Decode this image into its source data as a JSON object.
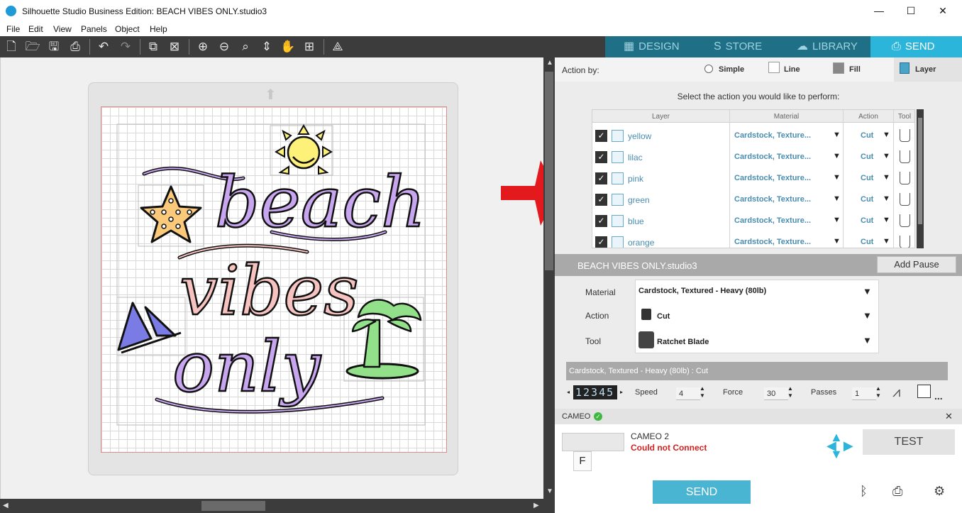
{
  "window": {
    "title": "Silhouette Studio Business Edition: BEACH VIBES ONLY.studio3",
    "minimize": "—",
    "maximize": "☐",
    "close": "✕"
  },
  "menu": [
    "File",
    "Edit",
    "View",
    "Panels",
    "Object",
    "Help"
  ],
  "nav_tabs": [
    {
      "label": "DESIGN",
      "icon": "grid-icon",
      "glyph": "▦"
    },
    {
      "label": "STORE",
      "icon": "store-s-icon",
      "glyph": "S"
    },
    {
      "label": "LIBRARY",
      "icon": "cloud-icon",
      "glyph": "☁"
    },
    {
      "label": "SEND",
      "icon": "cutter-icon",
      "glyph": "⎙"
    }
  ],
  "action_by": {
    "label": "Action by:",
    "options": [
      "Simple",
      "Line",
      "Fill",
      "Layer"
    ],
    "selected": "Layer"
  },
  "prompt": "Select the action you would like to perform:",
  "layer_table": {
    "headers": [
      "Layer",
      "Material",
      "Action",
      "Tool"
    ],
    "rows": [
      {
        "layer": "yellow",
        "material": "Cardstock, Texture...",
        "action": "Cut"
      },
      {
        "layer": "lilac",
        "material": "Cardstock, Texture...",
        "action": "Cut"
      },
      {
        "layer": "pink",
        "material": "Cardstock, Texture...",
        "action": "Cut"
      },
      {
        "layer": "green",
        "material": "Cardstock, Texture...",
        "action": "Cut"
      },
      {
        "layer": "blue",
        "material": "Cardstock, Texture...",
        "action": "Cut"
      },
      {
        "layer": "orange",
        "material": "Cardstock, Texture...",
        "action": "Cut"
      }
    ]
  },
  "file_bar": {
    "name": "BEACH VIBES ONLY.studio3",
    "add_pause": "Add Pause"
  },
  "properties": {
    "material_label": "Material",
    "material_value": "Cardstock, Textured - Heavy (80lb)",
    "action_label": "Action",
    "action_value": "Cut",
    "tool_label": "Tool",
    "tool_value": "Ratchet Blade"
  },
  "settings": {
    "title": "Cardstock, Textured - Heavy (80lb) : Cut",
    "blade_digits": "12345",
    "speed_label": "Speed",
    "speed_value": "4",
    "force_label": "Force",
    "force_value": "30",
    "passes_label": "Passes",
    "passes_value": "1",
    "more": "..."
  },
  "device": {
    "section_label": "CAMEO",
    "name": "CAMEO 2",
    "status": "Could not Connect",
    "test_label": "TEST",
    "send_label": "SEND",
    "device_letter": "F"
  },
  "colors": {
    "accent": "#2bb5da",
    "nav_bg": "#1f6f86",
    "toolbar_bg": "#3c3c3c",
    "error": "#d42020",
    "yellow": "#fdf17a",
    "lilac": "#c8a6ef",
    "pink": "#f7c3c0",
    "green": "#93e08a",
    "blue": "#7b7be6",
    "orange": "#fbc97a"
  }
}
